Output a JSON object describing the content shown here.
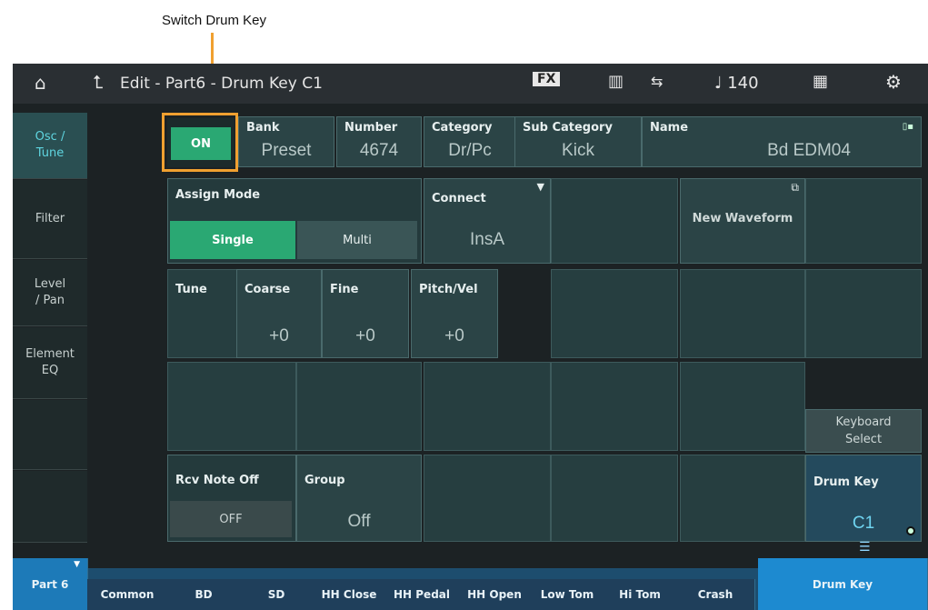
{
  "annotation": {
    "label": "Switch Drum Key"
  },
  "topbar": {
    "title": "Edit - Part6 - Drum Key C1",
    "fx_label": "FX",
    "tempo": "♩ 140"
  },
  "left_tabs": [
    {
      "label": "Osc /\nTune"
    },
    {
      "label": "Filter"
    },
    {
      "label": "Level\n/ Pan"
    },
    {
      "label": "Element\nEQ"
    }
  ],
  "header_row": {
    "switch_value": "ON",
    "bank_label": "Bank",
    "bank_value": "Preset",
    "number_label": "Number",
    "number_value": "4674",
    "category_label": "Category",
    "category_value": "Dr/Pc",
    "subcategory_label": "Sub Category",
    "subcategory_value": "Kick",
    "name_label": "Name",
    "name_value": "Bd EDM04"
  },
  "assign_mode": {
    "label": "Assign Mode",
    "single": "Single",
    "multi": "Multi"
  },
  "connect": {
    "label": "Connect",
    "value": "InsA"
  },
  "new_waveform": {
    "label": "New Waveform"
  },
  "tune": {
    "label": "Tune",
    "coarse_label": "Coarse",
    "coarse_value": "+0",
    "fine_label": "Fine",
    "fine_value": "+0",
    "pitchvel_label": "Pitch/Vel",
    "pitchvel_value": "+0"
  },
  "rcv_note_off": {
    "label": "Rcv Note Off",
    "value": "OFF"
  },
  "group": {
    "label": "Group",
    "value": "Off"
  },
  "keyboard_select": {
    "label": "Keyboard\nSelect"
  },
  "drum_key": {
    "label": "Drum Key",
    "value": "C1"
  },
  "bottom_tabs": [
    {
      "label": "Part 6"
    },
    {
      "label": "Common"
    },
    {
      "label": "BD"
    },
    {
      "label": "SD"
    },
    {
      "label": "HH Close"
    },
    {
      "label": "HH Pedal"
    },
    {
      "label": "HH Open"
    },
    {
      "label": "Low Tom"
    },
    {
      "label": "Hi Tom"
    },
    {
      "label": "Crash"
    },
    {
      "label": "Drum Key"
    }
  ]
}
